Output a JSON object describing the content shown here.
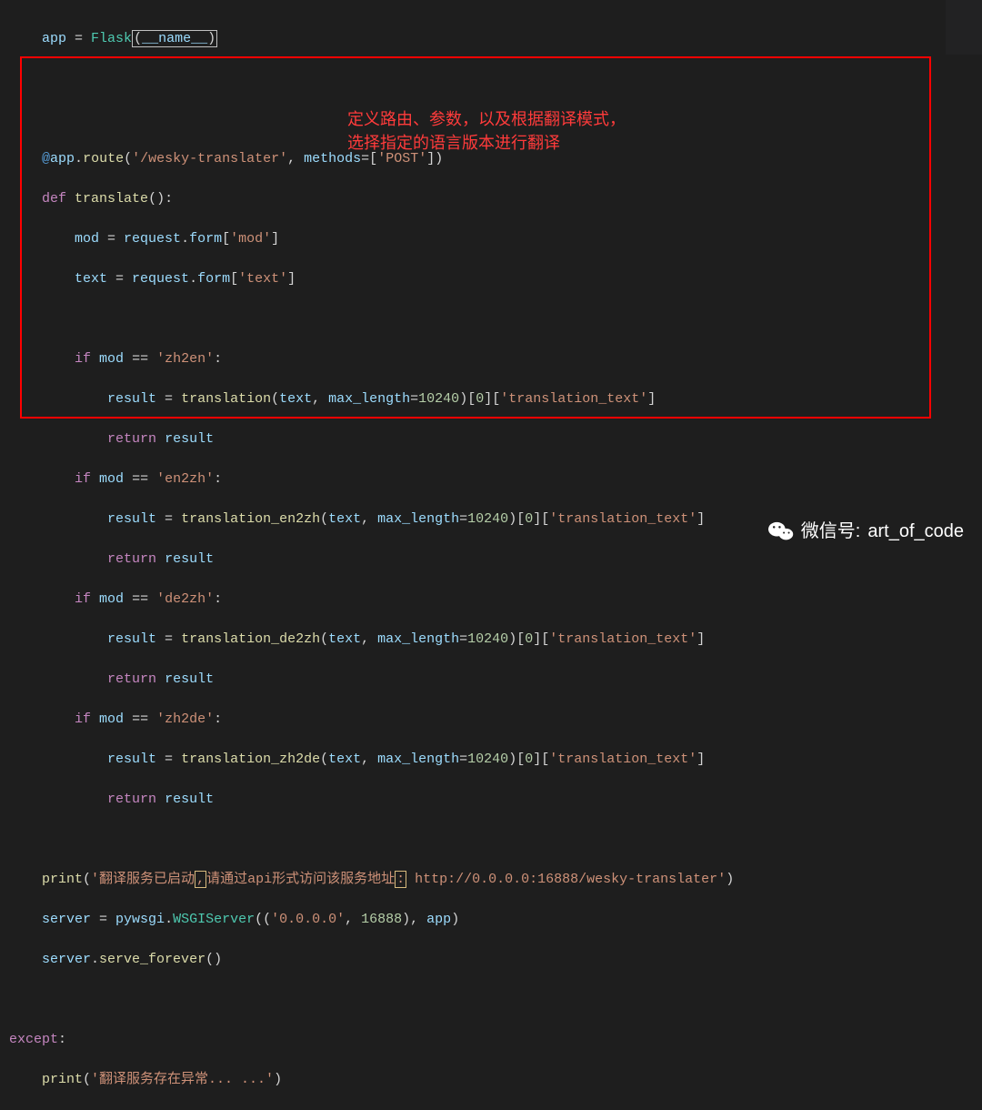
{
  "code": {
    "l0_app": "app",
    "l0_eq": " = ",
    "l0_flask": "Flask",
    "l0_name": "__name__",
    "dec_at": "@",
    "dec_app": "app",
    "dec_dot": ".",
    "dec_route": "route",
    "dec_open": "(",
    "dec_path": "'/wesky-translater'",
    "dec_comma": ", ",
    "dec_methods": "methods",
    "dec_eq": "=",
    "dec_list": "[",
    "dec_post": "'POST'",
    "dec_close": "])",
    "def_kw": "def",
    "def_sp": " ",
    "def_name": "translate",
    "def_paren": "():",
    "mod_var": "mod",
    "eq": " = ",
    "request": "request",
    "dot": ".",
    "form": "form",
    "br_open": "[",
    "mod_key": "'mod'",
    "br_close": "]",
    "text_var": "text",
    "text_key": "'text'",
    "if_kw": "if",
    "mod_ref": "mod",
    "eqeq": " == ",
    "zh2en": "'zh2en'",
    "en2zh": "'en2zh'",
    "de2zh": "'de2zh'",
    "zh2de": "'zh2de'",
    "colon": ":",
    "result_var": "result",
    "translation": "translation",
    "translation_en2zh": "translation_en2zh",
    "translation_de2zh": "translation_de2zh",
    "translation_zh2de": "translation_zh2de",
    "call_open": "(",
    "text_ref": "text",
    "comma_sp": ", ",
    "max_length": "max_length",
    "ml_eq": "=",
    "ml_val": "10240",
    "call_close": ")",
    "idx0": "[",
    "zero": "0",
    "idx0c": "]",
    "idx1": "[",
    "tt": "'translation_text'",
    "idx1c": "]",
    "return_kw": "return",
    "return_sp": " ",
    "result_ref": "result",
    "print_fn": "print",
    "print_open": "(",
    "print_str1": "'翻译服务已启动",
    "print_mid": "请通过api形式访问该服务地址",
    "print_url": "http://0.0.0.0:16888/wesky-translater",
    "print_end": "'",
    "print_close": ")",
    "server_var": "server",
    "pywsgi": "pywsgi",
    "wsgiserver": "WSGIServer",
    "ws_open": "((",
    "ws_host": "'0.0.0.0'",
    "ws_comma": ", ",
    "ws_port": "16888",
    "ws_mid": "), ",
    "ws_app": "app",
    "ws_close": ")",
    "serve_forever": "serve_forever",
    "sf_call": "()",
    "except_kw": "except",
    "except_colon": ":",
    "ex_print_str": "'翻译服务存在异常... ...'"
  },
  "annotation": {
    "line1": "定义路由、参数，以及根据翻译模式，",
    "line2": "选择指定的语言版本进行翻译"
  },
  "watermark": {
    "label": "微信号:",
    "value": "art_of_code"
  }
}
